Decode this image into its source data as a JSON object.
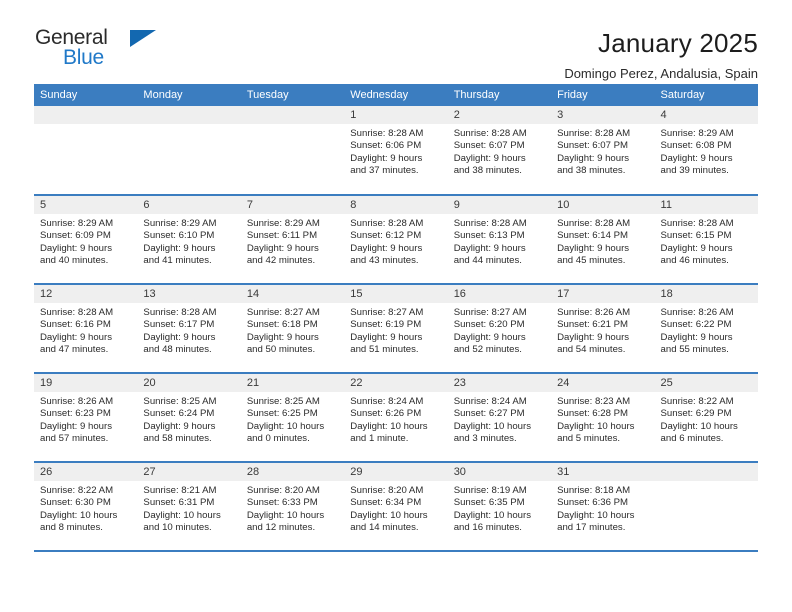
{
  "brand": {
    "name_top": "General",
    "name_bottom": "Blue",
    "triangle_color": "#1368b0",
    "blue_text_color": "#2079c8"
  },
  "header": {
    "title": "January 2025",
    "subtitle": "Domingo Perez, Andalusia, Spain"
  },
  "theme": {
    "header_bg": "#3b7dc0",
    "header_text": "#ffffff",
    "daynum_bg": "#efefef",
    "row_separator": "#3b7dc0"
  },
  "weekdays": [
    "Sunday",
    "Monday",
    "Tuesday",
    "Wednesday",
    "Thursday",
    "Friday",
    "Saturday"
  ],
  "weeks": [
    [
      {
        "day": "",
        "lines": []
      },
      {
        "day": "",
        "lines": []
      },
      {
        "day": "",
        "lines": []
      },
      {
        "day": "1",
        "lines": [
          "Sunrise: 8:28 AM",
          "Sunset: 6:06 PM",
          "Daylight: 9 hours",
          "and 37 minutes."
        ]
      },
      {
        "day": "2",
        "lines": [
          "Sunrise: 8:28 AM",
          "Sunset: 6:07 PM",
          "Daylight: 9 hours",
          "and 38 minutes."
        ]
      },
      {
        "day": "3",
        "lines": [
          "Sunrise: 8:28 AM",
          "Sunset: 6:07 PM",
          "Daylight: 9 hours",
          "and 38 minutes."
        ]
      },
      {
        "day": "4",
        "lines": [
          "Sunrise: 8:29 AM",
          "Sunset: 6:08 PM",
          "Daylight: 9 hours",
          "and 39 minutes."
        ]
      }
    ],
    [
      {
        "day": "5",
        "lines": [
          "Sunrise: 8:29 AM",
          "Sunset: 6:09 PM",
          "Daylight: 9 hours",
          "and 40 minutes."
        ]
      },
      {
        "day": "6",
        "lines": [
          "Sunrise: 8:29 AM",
          "Sunset: 6:10 PM",
          "Daylight: 9 hours",
          "and 41 minutes."
        ]
      },
      {
        "day": "7",
        "lines": [
          "Sunrise: 8:29 AM",
          "Sunset: 6:11 PM",
          "Daylight: 9 hours",
          "and 42 minutes."
        ]
      },
      {
        "day": "8",
        "lines": [
          "Sunrise: 8:28 AM",
          "Sunset: 6:12 PM",
          "Daylight: 9 hours",
          "and 43 minutes."
        ]
      },
      {
        "day": "9",
        "lines": [
          "Sunrise: 8:28 AM",
          "Sunset: 6:13 PM",
          "Daylight: 9 hours",
          "and 44 minutes."
        ]
      },
      {
        "day": "10",
        "lines": [
          "Sunrise: 8:28 AM",
          "Sunset: 6:14 PM",
          "Daylight: 9 hours",
          "and 45 minutes."
        ]
      },
      {
        "day": "11",
        "lines": [
          "Sunrise: 8:28 AM",
          "Sunset: 6:15 PM",
          "Daylight: 9 hours",
          "and 46 minutes."
        ]
      }
    ],
    [
      {
        "day": "12",
        "lines": [
          "Sunrise: 8:28 AM",
          "Sunset: 6:16 PM",
          "Daylight: 9 hours",
          "and 47 minutes."
        ]
      },
      {
        "day": "13",
        "lines": [
          "Sunrise: 8:28 AM",
          "Sunset: 6:17 PM",
          "Daylight: 9 hours",
          "and 48 minutes."
        ]
      },
      {
        "day": "14",
        "lines": [
          "Sunrise: 8:27 AM",
          "Sunset: 6:18 PM",
          "Daylight: 9 hours",
          "and 50 minutes."
        ]
      },
      {
        "day": "15",
        "lines": [
          "Sunrise: 8:27 AM",
          "Sunset: 6:19 PM",
          "Daylight: 9 hours",
          "and 51 minutes."
        ]
      },
      {
        "day": "16",
        "lines": [
          "Sunrise: 8:27 AM",
          "Sunset: 6:20 PM",
          "Daylight: 9 hours",
          "and 52 minutes."
        ]
      },
      {
        "day": "17",
        "lines": [
          "Sunrise: 8:26 AM",
          "Sunset: 6:21 PM",
          "Daylight: 9 hours",
          "and 54 minutes."
        ]
      },
      {
        "day": "18",
        "lines": [
          "Sunrise: 8:26 AM",
          "Sunset: 6:22 PM",
          "Daylight: 9 hours",
          "and 55 minutes."
        ]
      }
    ],
    [
      {
        "day": "19",
        "lines": [
          "Sunrise: 8:26 AM",
          "Sunset: 6:23 PM",
          "Daylight: 9 hours",
          "and 57 minutes."
        ]
      },
      {
        "day": "20",
        "lines": [
          "Sunrise: 8:25 AM",
          "Sunset: 6:24 PM",
          "Daylight: 9 hours",
          "and 58 minutes."
        ]
      },
      {
        "day": "21",
        "lines": [
          "Sunrise: 8:25 AM",
          "Sunset: 6:25 PM",
          "Daylight: 10 hours",
          "and 0 minutes."
        ]
      },
      {
        "day": "22",
        "lines": [
          "Sunrise: 8:24 AM",
          "Sunset: 6:26 PM",
          "Daylight: 10 hours",
          "and 1 minute."
        ]
      },
      {
        "day": "23",
        "lines": [
          "Sunrise: 8:24 AM",
          "Sunset: 6:27 PM",
          "Daylight: 10 hours",
          "and 3 minutes."
        ]
      },
      {
        "day": "24",
        "lines": [
          "Sunrise: 8:23 AM",
          "Sunset: 6:28 PM",
          "Daylight: 10 hours",
          "and 5 minutes."
        ]
      },
      {
        "day": "25",
        "lines": [
          "Sunrise: 8:22 AM",
          "Sunset: 6:29 PM",
          "Daylight: 10 hours",
          "and 6 minutes."
        ]
      }
    ],
    [
      {
        "day": "26",
        "lines": [
          "Sunrise: 8:22 AM",
          "Sunset: 6:30 PM",
          "Daylight: 10 hours",
          "and 8 minutes."
        ]
      },
      {
        "day": "27",
        "lines": [
          "Sunrise: 8:21 AM",
          "Sunset: 6:31 PM",
          "Daylight: 10 hours",
          "and 10 minutes."
        ]
      },
      {
        "day": "28",
        "lines": [
          "Sunrise: 8:20 AM",
          "Sunset: 6:33 PM",
          "Daylight: 10 hours",
          "and 12 minutes."
        ]
      },
      {
        "day": "29",
        "lines": [
          "Sunrise: 8:20 AM",
          "Sunset: 6:34 PM",
          "Daylight: 10 hours",
          "and 14 minutes."
        ]
      },
      {
        "day": "30",
        "lines": [
          "Sunrise: 8:19 AM",
          "Sunset: 6:35 PM",
          "Daylight: 10 hours",
          "and 16 minutes."
        ]
      },
      {
        "day": "31",
        "lines": [
          "Sunrise: 8:18 AM",
          "Sunset: 6:36 PM",
          "Daylight: 10 hours",
          "and 17 minutes."
        ]
      },
      {
        "day": "",
        "lines": []
      }
    ]
  ]
}
